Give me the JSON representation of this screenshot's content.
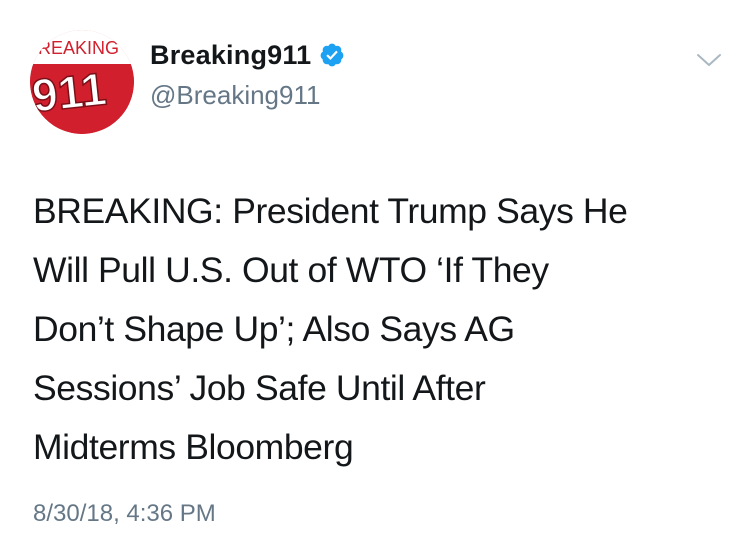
{
  "account": {
    "display_name": "Breaking911",
    "handle": "@Breaking911",
    "verified": true,
    "avatar": {
      "top_text": "BREAKING",
      "main_text": "911",
      "background_color": "#d11f2d",
      "text_color": "#ffffff"
    }
  },
  "tweet": {
    "text": "BREAKING: President Trump Says He\nWill Pull U.S. Out of WTO ‘If They\nDon’t Shape Up’; Also Says AG\nSessions’ Job Safe Until After\nMidterms Bloomberg",
    "timestamp": "8/30/18, 4:36 PM"
  },
  "icons": {
    "verified": "verified-badge-icon",
    "menu": "chevron-down-icon"
  },
  "colors": {
    "verified_blue": "#1da1f2",
    "secondary_text": "#657786",
    "primary_text": "#14171a"
  }
}
